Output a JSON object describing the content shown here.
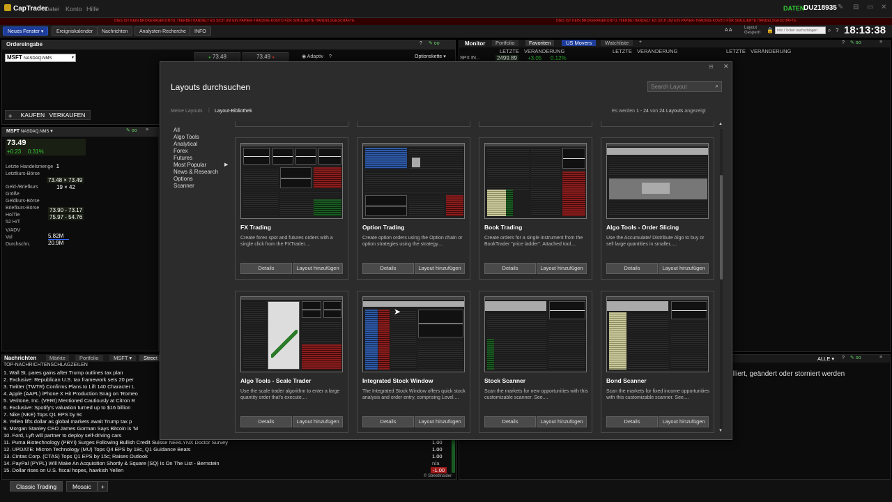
{
  "app": {
    "name": "CapTrader",
    "menu": [
      "Datei",
      "Konto",
      "Hilfe"
    ],
    "status": "DATEN",
    "account_id": "DU218935",
    "warning_text": "DIES IST KEIN BROKERAGEKONTO. HIERBEI HANDELT ES SICH UM EIN PAPIER-TRADING-KONTO FÜR SIMULIERTE HANDELSGESCHÄFTE.",
    "clock": "18:13:38"
  },
  "toolbar": {
    "buttons": [
      "Neues Fenster ▾",
      "Ereigniskalender",
      "Nachrichten",
      "Analysten-Recherche",
      "INFO"
    ],
    "kbd": "A A",
    "layout_status": [
      "Layout",
      "Gesperrt"
    ],
    "ticker_placeholder": "Info / Ticker nachschlagen"
  },
  "order_panel": {
    "title": "Ordereingabe",
    "symbol": "MSFT",
    "exchange": "NASDAQ.NMS",
    "bid": "73.48",
    "ask": "73.49",
    "adaptive": "Adaptiv",
    "help": "?",
    "option_chain": "Optionskette ▾",
    "buy": "KAUFEN",
    "sell": "VERKAUFEN"
  },
  "quote_panel": {
    "symbol": "MSFT",
    "exchange": "NASDAQ.NMS",
    "price": "73.49",
    "change": "+0.23",
    "change_pct": "0.31%",
    "rows": [
      {
        "label": "Letzte Handelsmenge",
        "value": "1"
      },
      {
        "label": "Letztkurs-Börse",
        "value": ""
      },
      {
        "label": "Geld-/Briefkurs",
        "value": "73.48 × 73.49"
      },
      {
        "label": "Größe",
        "value": "19 × 42"
      },
      {
        "label": "Geldkurs-Börse",
        "value": ""
      },
      {
        "label": "Briefkurs-Börse",
        "value": ""
      },
      {
        "label": "Ho/Tie",
        "value": "73.90 - 73.17"
      },
      {
        "label": "52 H/T",
        "value": "75.97 - 54.76"
      },
      {
        "label": "V/ADV",
        "value": ""
      },
      {
        "label": "Vol",
        "value": "5.82M"
      },
      {
        "label": "Durchschn.",
        "value": "20.9M"
      }
    ]
  },
  "monitor": {
    "tabs": [
      "Monitor",
      "Portfolio",
      "Favoriten",
      "US Movers",
      "Watchliste"
    ],
    "cols": [
      "LETZTE",
      "VERÄNDERUNG"
    ],
    "row": {
      "symbol": "SPX IN...",
      "last": "2499.89",
      "change": "+3.05",
      "pct": "0.12%"
    }
  },
  "dialog": {
    "title": "Layouts durchsuchen",
    "search_placeholder": "Search Layout",
    "tabs": [
      "Meine Layouts",
      "Layout-Bibliothek"
    ],
    "results_pre": "Es werden",
    "results_range": "1 - 24",
    "results_mid": "von",
    "results_count": "24 Layouts",
    "results_post": "angezeigt",
    "categories": [
      "All",
      "Algo Tools",
      "Analytical",
      "Forex",
      "Futures",
      "Most Popular",
      "News & Research",
      "Options",
      "Scanner"
    ],
    "btn_details": "Details",
    "btn_add": "Layout hinzufügen",
    "cards": [
      {
        "title": "FX Trading",
        "desc": "Create forex spot and futures orders with a single click from the FXTrader...."
      },
      {
        "title": "Option Trading",
        "desc": "Create option orders using the Option chain or option strategies using the strategy...."
      },
      {
        "title": "Book Trading",
        "desc": "Create orders for a single instrument from the BookTrader \"price ladder\". Attached tool...."
      },
      {
        "title": "Algo Tools - Order Slicing",
        "desc": "Use the Accumulate/ Distribute Algo to buy or sell large quantities in smaller,...."
      },
      {
        "title": "Algo Tools - Scale Trader",
        "desc": "Use the scale trader algorithm to enter a large quantity order that's execute...."
      },
      {
        "title": "Integrated Stock Window",
        "desc": "The Integrated Stock Window offers quick stock analysis and order entry, comprising Level...."
      },
      {
        "title": "Stock Scanner",
        "desc": "Scan the markets for new opportunities with this customizable scanner. See...."
      },
      {
        "title": "Bond Scanner",
        "desc": "Scan the markets for fixed income opportunities with this customizable scanner. See...."
      }
    ]
  },
  "news": {
    "tabs": [
      "Nachrichten",
      "Märkte",
      "Portfolio",
      "MSFT ▾",
      "Street"
    ],
    "header": "TOP-NACHRICHTENSCHLAGZEILEN",
    "items": [
      "1.   Wall St. pares gains after Trump outlines tax plan",
      "2.   Exclusive: Republican U.S. tax framework sets 20 per",
      "3.   Twitter (TWTR) Confirms Plans to Lift 140 Character L",
      "4.   Apple (AAPL) iPhone X Hit Production Snag on 'Romeo",
      "5.   Veritone, Inc. (VERI) Mentioned Cautiously at Citron R",
      "6.   Exclusive: Spotify's valuation turned up to $16 billion",
      "7.   Nike (NKE) Tops Q1 EPS by 9c",
      "8.   Yellen lifts dollar as global markets await Trump tax p",
      "9.   Morgan Stanley CEO James Gorman Says Bitcoin is 'M",
      "10.  Ford, Lyft will partner to deploy self-driving cars",
      "11.  Puma Biotechnology (PBYI) Surges Following Bullish Credit Suisse NERLYNX Doctor Survey",
      "12.  UPDATE: Micron Technology (MU) Tops Q4 EPS by 18c, Q1 Guidance Beats",
      "13.  Cintas Corp. (CTAS) Tops Q1 EPS by 15c; Raises Outlook",
      "14.  PayPal  (PYPL) Will Make An Acquisition Shortly & Square (SQ) Is On The List - Bernstein",
      "15.  Dollar rises on U.S. fiscal hopes, hawkish Yellen"
    ],
    "values": [
      "1.00",
      "1.00",
      "1.00",
      "n/a",
      "-1.00"
    ],
    "source": "© StreetInsider"
  },
  "orders_panel": {
    "filter": "ALLE ▾",
    "message": "olliert, geändert oder storniert werden"
  },
  "bottom_tabs": [
    "Classic Trading",
    "Mosaic",
    "+"
  ],
  "colors": {
    "accent_blue": "#1e3d9a",
    "up_green": "#33cc33",
    "down_red": "#cc2222",
    "status_green": "#33cc33"
  }
}
